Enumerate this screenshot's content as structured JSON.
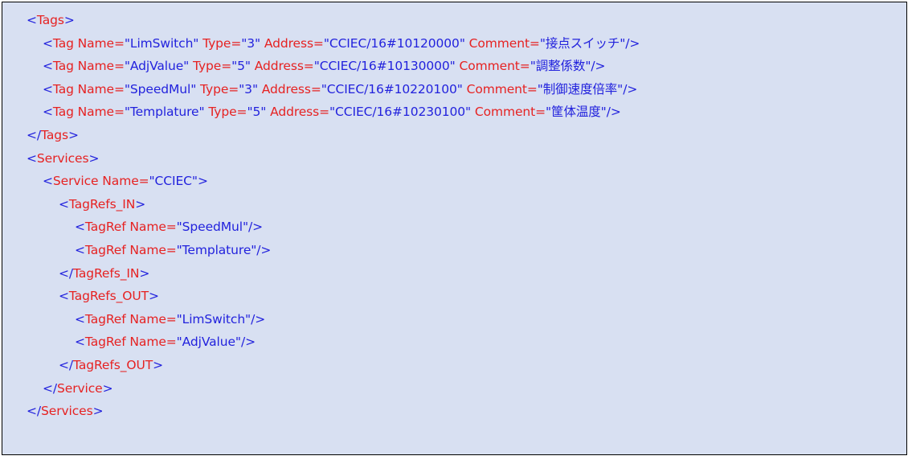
{
  "document": {
    "kind": "xml-code-block",
    "colors": {
      "background": "#d8e0f2",
      "border": "#000000",
      "markup_punctuation": "#2222dd",
      "element_and_attribute_name": "#e62222",
      "attribute_value": "#2222dd",
      "page": "#ffffff"
    }
  },
  "code": {
    "lines": [
      {
        "indent": 0,
        "tokens": [
          {
            "text": "<",
            "color": "blue"
          },
          {
            "text": "Tags",
            "color": "red"
          },
          {
            "text": ">",
            "color": "blue"
          }
        ]
      },
      {
        "indent": 1,
        "tokens": [
          {
            "text": "<",
            "color": "blue"
          },
          {
            "text": "Tag Name=",
            "color": "red"
          },
          {
            "text": "\"LimSwitch\"",
            "color": "blue"
          },
          {
            "text": " Type=",
            "color": "red"
          },
          {
            "text": "\"3\"",
            "color": "blue"
          },
          {
            "text": " Address=",
            "color": "red"
          },
          {
            "text": "\"CCIEC/16#10120000\"",
            "color": "blue"
          },
          {
            "text": " Comment=",
            "color": "red"
          },
          {
            "text": "\"接点スイッチ\"",
            "color": "blue"
          },
          {
            "text": "/>",
            "color": "blue"
          }
        ]
      },
      {
        "indent": 1,
        "tokens": [
          {
            "text": "<",
            "color": "blue"
          },
          {
            "text": "Tag Name=",
            "color": "red"
          },
          {
            "text": "\"AdjValue\"",
            "color": "blue"
          },
          {
            "text": " Type=",
            "color": "red"
          },
          {
            "text": "\"5\"",
            "color": "blue"
          },
          {
            "text": " Address=",
            "color": "red"
          },
          {
            "text": "\"CCIEC/16#10130000\"",
            "color": "blue"
          },
          {
            "text": " Comment=",
            "color": "red"
          },
          {
            "text": "\"調整係数\"",
            "color": "blue"
          },
          {
            "text": "/>",
            "color": "blue"
          }
        ]
      },
      {
        "indent": 1,
        "tokens": [
          {
            "text": "<",
            "color": "blue"
          },
          {
            "text": "Tag Name=",
            "color": "red"
          },
          {
            "text": "\"SpeedMul\"",
            "color": "blue"
          },
          {
            "text": " Type=",
            "color": "red"
          },
          {
            "text": "\"3\"",
            "color": "blue"
          },
          {
            "text": " Address=",
            "color": "red"
          },
          {
            "text": "\"CCIEC/16#10220100\"",
            "color": "blue"
          },
          {
            "text": " Comment=",
            "color": "red"
          },
          {
            "text": "\"制御速度倍率\"",
            "color": "blue"
          },
          {
            "text": "/>",
            "color": "blue"
          }
        ]
      },
      {
        "indent": 1,
        "tokens": [
          {
            "text": "<",
            "color": "blue"
          },
          {
            "text": "Tag Name=",
            "color": "red"
          },
          {
            "text": "\"Templature\"",
            "color": "blue"
          },
          {
            "text": " Type=",
            "color": "red"
          },
          {
            "text": "\"5\"",
            "color": "blue"
          },
          {
            "text": " Address=",
            "color": "red"
          },
          {
            "text": "\"CCIEC/16#10230100\"",
            "color": "blue"
          },
          {
            "text": " Comment=",
            "color": "red"
          },
          {
            "text": "\"筐体温度\"",
            "color": "blue"
          },
          {
            "text": "/>",
            "color": "blue"
          }
        ]
      },
      {
        "indent": 0,
        "tokens": [
          {
            "text": "</",
            "color": "blue"
          },
          {
            "text": "Tags",
            "color": "red"
          },
          {
            "text": ">",
            "color": "blue"
          }
        ]
      },
      {
        "indent": 0,
        "tokens": [
          {
            "text": "<",
            "color": "blue"
          },
          {
            "text": "Services",
            "color": "red"
          },
          {
            "text": ">",
            "color": "blue"
          }
        ]
      },
      {
        "indent": 1,
        "tokens": [
          {
            "text": "<",
            "color": "blue"
          },
          {
            "text": "Service Name=",
            "color": "red"
          },
          {
            "text": "\"CCIEC\"",
            "color": "blue"
          },
          {
            "text": ">",
            "color": "blue"
          }
        ]
      },
      {
        "indent": 2,
        "tokens": [
          {
            "text": "<",
            "color": "blue"
          },
          {
            "text": "TagRefs_IN",
            "color": "red"
          },
          {
            "text": ">",
            "color": "blue"
          }
        ]
      },
      {
        "indent": 3,
        "tokens": [
          {
            "text": "<",
            "color": "blue"
          },
          {
            "text": "TagRef Name=",
            "color": "red"
          },
          {
            "text": "\"SpeedMul\"",
            "color": "blue"
          },
          {
            "text": "/>",
            "color": "blue"
          }
        ]
      },
      {
        "indent": 3,
        "tokens": [
          {
            "text": "<",
            "color": "blue"
          },
          {
            "text": "TagRef Name=",
            "color": "red"
          },
          {
            "text": "\"Templature\"",
            "color": "blue"
          },
          {
            "text": "/>",
            "color": "blue"
          }
        ]
      },
      {
        "indent": 2,
        "tokens": [
          {
            "text": "</",
            "color": "blue"
          },
          {
            "text": "TagRefs_IN",
            "color": "red"
          },
          {
            "text": ">",
            "color": "blue"
          }
        ]
      },
      {
        "indent": 2,
        "tokens": [
          {
            "text": "<",
            "color": "blue"
          },
          {
            "text": "TagRefs_OUT",
            "color": "red"
          },
          {
            "text": ">",
            "color": "blue"
          }
        ]
      },
      {
        "indent": 3,
        "tokens": [
          {
            "text": "<",
            "color": "blue"
          },
          {
            "text": "TagRef Name=",
            "color": "red"
          },
          {
            "text": "\"LimSwitch\"",
            "color": "blue"
          },
          {
            "text": "/>",
            "color": "blue"
          }
        ]
      },
      {
        "indent": 3,
        "tokens": [
          {
            "text": "<",
            "color": "blue"
          },
          {
            "text": "TagRef Name=",
            "color": "red"
          },
          {
            "text": "\"AdjValue\"",
            "color": "blue"
          },
          {
            "text": "/>",
            "color": "blue"
          }
        ]
      },
      {
        "indent": 2,
        "tokens": [
          {
            "text": "</",
            "color": "blue"
          },
          {
            "text": "TagRefs_OUT",
            "color": "red"
          },
          {
            "text": ">",
            "color": "blue"
          }
        ]
      },
      {
        "indent": 1,
        "tokens": [
          {
            "text": "</",
            "color": "blue"
          },
          {
            "text": "Service",
            "color": "red"
          },
          {
            "text": ">",
            "color": "blue"
          }
        ]
      },
      {
        "indent": 0,
        "tokens": [
          {
            "text": "</",
            "color": "blue"
          },
          {
            "text": "Services",
            "color": "red"
          },
          {
            "text": ">",
            "color": "blue"
          }
        ]
      }
    ]
  }
}
